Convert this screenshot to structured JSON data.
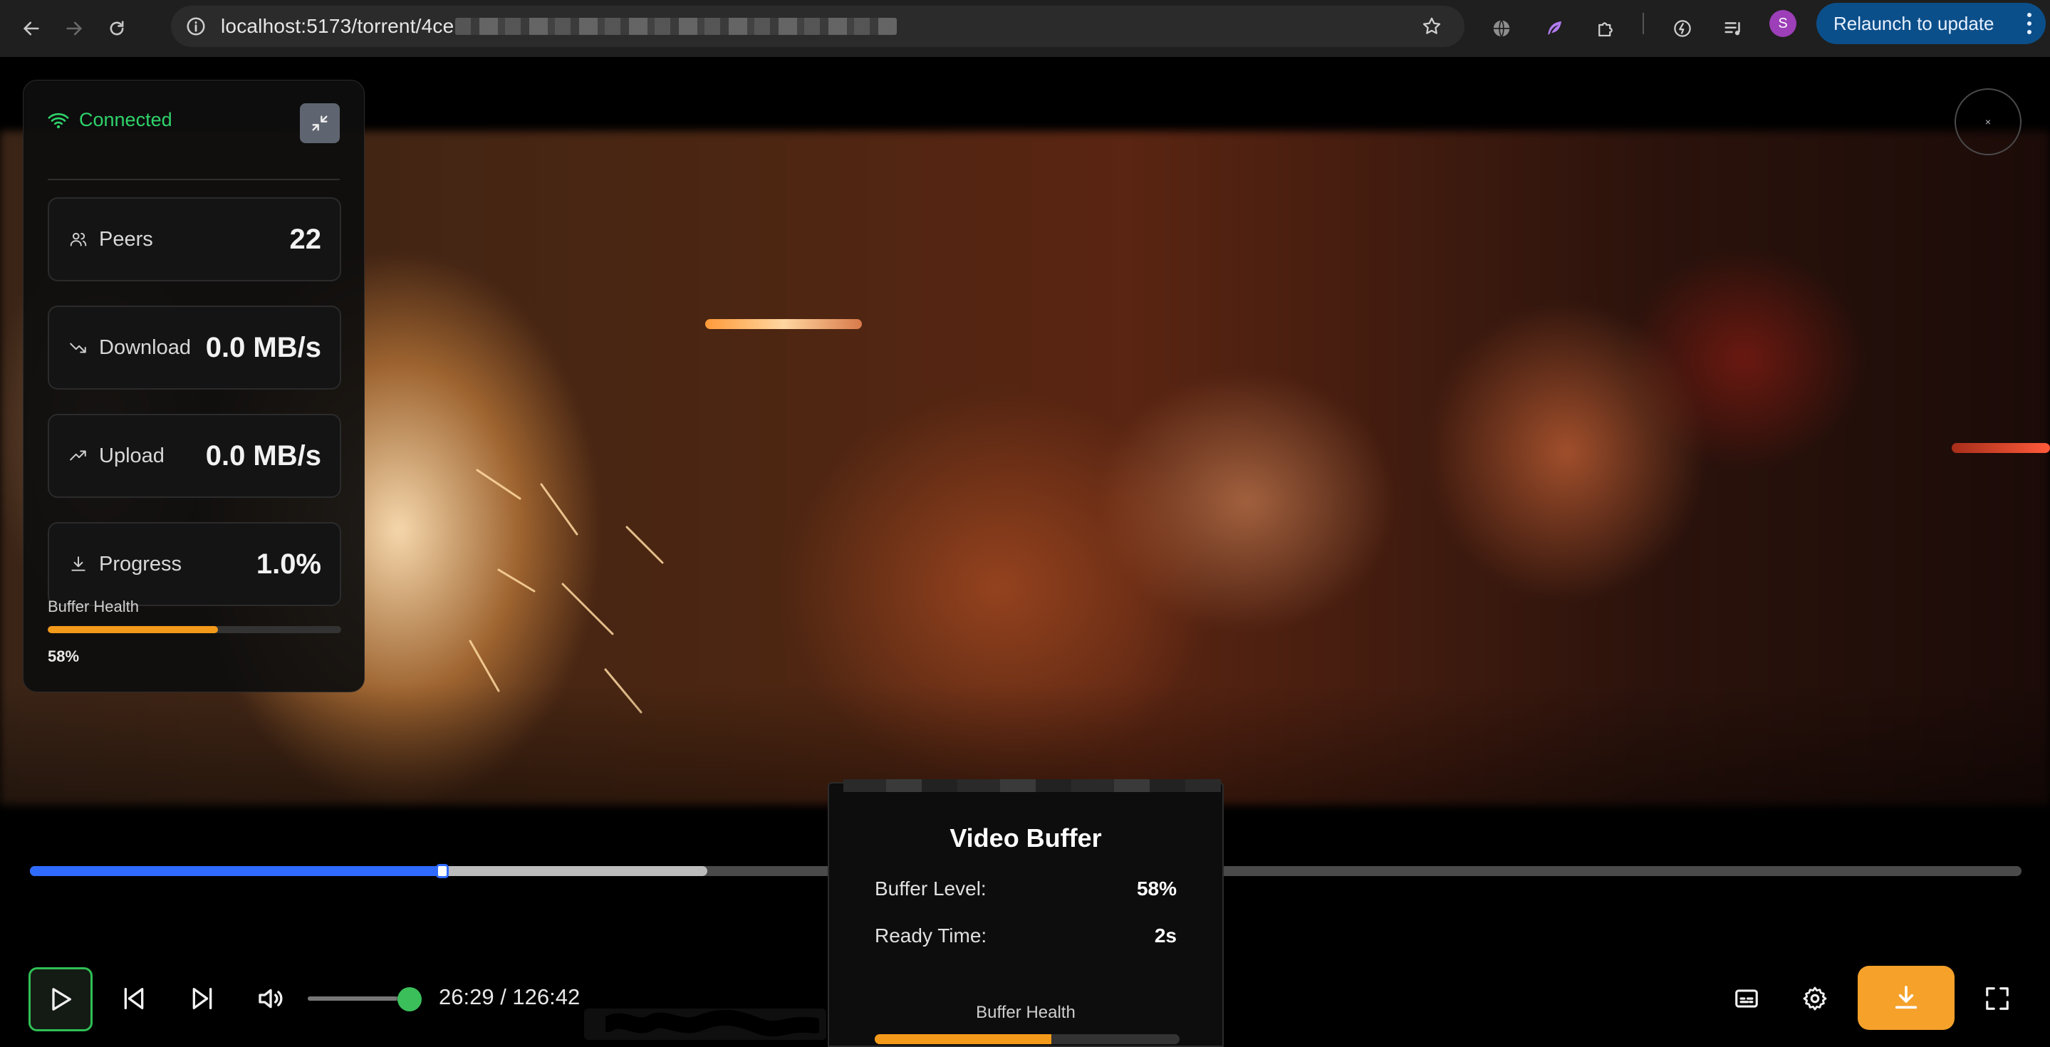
{
  "browser": {
    "url": "localhost:5173/torrent/4ce",
    "relaunch_label": "Relaunch to update",
    "profile_initial": "S"
  },
  "stats": {
    "connection": "Connected",
    "peers_label": "Peers",
    "peers_value": "22",
    "download_label": "Download",
    "download_value": "0.0 MB/s",
    "upload_label": "Upload",
    "upload_value": "0.0 MB/s",
    "progress_label": "Progress",
    "progress_value": "1.0%",
    "buffer_health_label": "Buffer Health",
    "buffer_health_value": "58%",
    "buffer_health_fraction": 0.58
  },
  "close_button": {
    "label": "×"
  },
  "seek": {
    "played_fraction": 0.207,
    "buffered_fraction": 0.34
  },
  "controls": {
    "time": "26:29 / 126:42",
    "volume_fraction": 0.87
  },
  "buffer_popup": {
    "title": "Video Buffer",
    "level_label": "Buffer Level:",
    "level_value": "58%",
    "ready_label": "Ready Time:",
    "ready_value": "2s",
    "health_label": "Buffer Health",
    "health_fraction": 0.58
  },
  "colors": {
    "connected": "#2fd36a",
    "accent_orange": "#f39a1a",
    "played_blue": "#2f6bff",
    "play_border": "#2fbf55",
    "relaunch_bg": "#0b4f8a"
  }
}
